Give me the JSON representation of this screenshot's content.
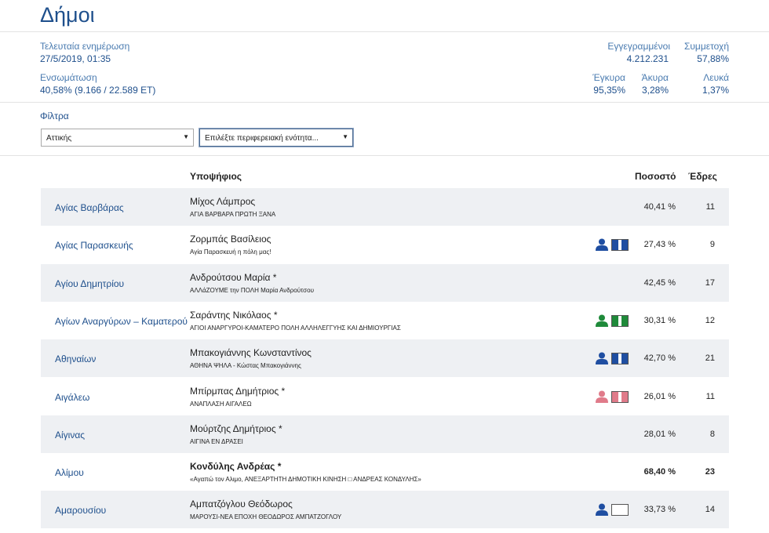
{
  "page_title": "Δήμοι",
  "stats": {
    "last_update_label": "Τελευταία ενημέρωση",
    "last_update_value": "27/5/2019, 01:35",
    "integration_label": "Ενσωμάτωση",
    "integration_value": "40,58% (9.166 / 22.589 ΕΤ)",
    "registered_label": "Εγγεγραμμένοι",
    "registered_value": "4.212.231",
    "turnout_label": "Συμμετοχή",
    "turnout_value": "57,88%",
    "valid_label": "Έγκυρα",
    "valid_value": "95,35%",
    "invalid_label": "Άκυρα",
    "invalid_value": "3,28%",
    "blank_label": "Λευκά",
    "blank_value": "1,37%"
  },
  "filters": {
    "label": "Φίλτρα",
    "region_selected": "Αττικής",
    "unit_placeholder": "Επιλέξτε περιφερειακή ενότητα..."
  },
  "table": {
    "col_candidate": "Υποψήφιος",
    "col_percent": "Ποσοστό",
    "col_seats": "Έδρες",
    "rows": [
      {
        "municipality": "Αγίας Βαρβάρας",
        "candidate": "Μίχος Λάμπρος",
        "party": "ΑΓΙΑ ΒΑΡΒΑΡΑ ΠΡΩΤΗ ΞΑΝΑ",
        "percent": "40,41 %",
        "seats": "11",
        "icon_color": "",
        "bold": false
      },
      {
        "municipality": "Αγίας Παρασκευής",
        "candidate": "Ζορμπάς Βασίλειος",
        "party": "Αγία Παρασκευή η πόλη μας!",
        "percent": "27,43 %",
        "seats": "9",
        "icon_color": "#1f4ea1",
        "bold": false
      },
      {
        "municipality": "Αγίου Δημητρίου",
        "candidate": "Ανδρούτσου Μαρία *",
        "party": "ΑΛΛάΖΟΥΜΕ την ΠΟΛΗ Μαρία Ανδρούτσου",
        "percent": "42,45 %",
        "seats": "17",
        "icon_color": "",
        "bold": false
      },
      {
        "municipality": "Αγίων Αναργύρων – Καματερού",
        "candidate": "Σαράντης Νικόλαος *",
        "party": "ΑΓΙΟΙ ΑΝΑΡΓΥΡΟΙ-ΚΑΜΑΤΕΡΟ ΠΟΛΗ ΑΛΛΗΛΕΓΓΥΗΣ ΚΑΙ ΔΗΜΙΟΥΡΓΙΑΣ",
        "percent": "30,31 %",
        "seats": "12",
        "icon_color": "#1f8a3a",
        "bold": false
      },
      {
        "municipality": "Αθηναίων",
        "candidate": "Μπακογιάννης Κωνσταντίνος",
        "party": "ΑΘΗΝΑ ΨΗΛΑ - Κώστας Μπακογιάννης",
        "percent": "42,70 %",
        "seats": "21",
        "icon_color": "#1f4ea1",
        "bold": false
      },
      {
        "municipality": "Αιγάλεω",
        "candidate": "Μπίρμπας Δημήτριος *",
        "party": "ΑΝΑΠΛΑΣΗ ΑΙΓΑΛΕΩ",
        "percent": "26,01 %",
        "seats": "11",
        "icon_color": "#e07b8a",
        "bold": false
      },
      {
        "municipality": "Αίγινας",
        "candidate": "Μούρτζης Δημήτριος *",
        "party": "ΑΙΓΙΝΑ ΕΝ ΔΡΑΣΕΙ",
        "percent": "28,01 %",
        "seats": "8",
        "icon_color": "",
        "bold": false
      },
      {
        "municipality": "Αλίμου",
        "candidate": "Κονδύλης Ανδρέας *",
        "party": "«Αγαπώ τον Αλιμο, ΑΝΕΞΑΡΤΗΤΗ ΔΗΜΟΤΙΚΗ ΚΙΝΗΣΗ □ ΑΝΔΡΕΑΣ ΚΟΝΔΥΛΗΣ»",
        "percent": "68,40 %",
        "seats": "23",
        "icon_color": "",
        "bold": true
      },
      {
        "municipality": "Αμαρουσίου",
        "candidate": "Αμπατζόγλου Θεόδωρος",
        "party": "ΜΑΡΟΥΣΙ-ΝΕΑ ΕΠΟΧΗ ΘΕΟΔΩΡΟΣ ΑΜΠΑΤΖΟΓΛΟΥ",
        "percent": "33,73 %",
        "seats": "14",
        "icon_color": "#1f4ea1",
        "icon_hollow": true,
        "bold": false
      }
    ]
  }
}
